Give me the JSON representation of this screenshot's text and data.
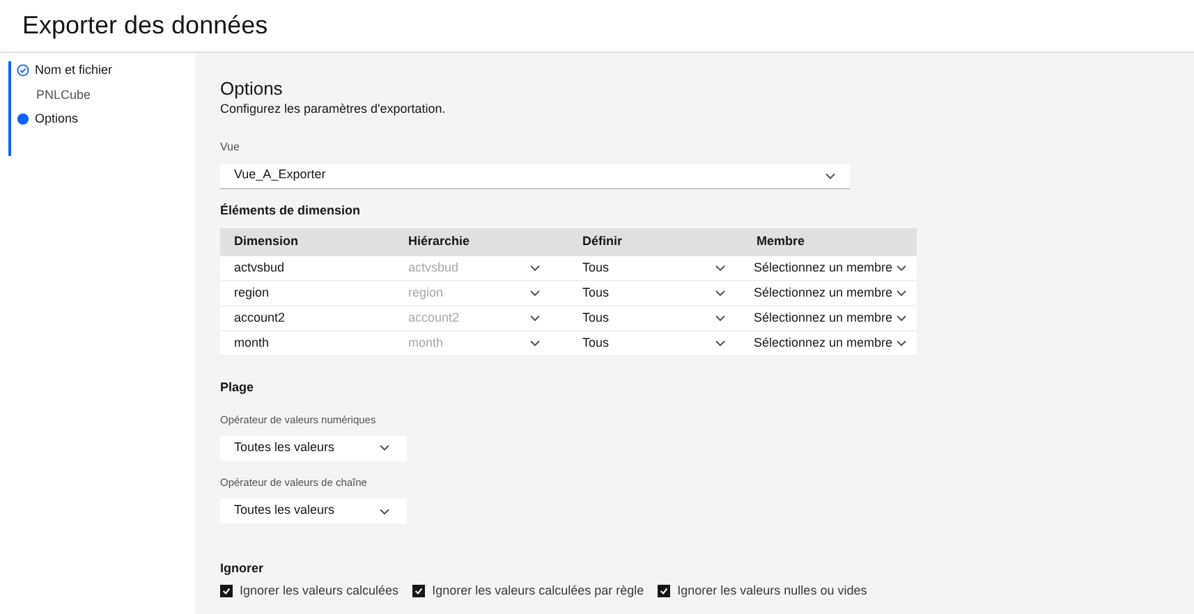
{
  "header": {
    "title": "Exporter des données"
  },
  "steps": [
    {
      "label": "Nom et fichier",
      "kind": "complete",
      "detail": "PNLCube"
    },
    {
      "label": "Options",
      "kind": "current"
    }
  ],
  "options": {
    "title": "Options",
    "subtitle": "Configurez les paramètres d'exportation.",
    "view": {
      "label": "Vue",
      "value": "Vue_A_Exporter"
    },
    "dimensions": {
      "title": "Éléments de dimension",
      "columns": [
        "Dimension",
        "Hiérarchie",
        "Définir",
        "Membre"
      ],
      "rows": [
        {
          "dimension": "actvsbud",
          "hierarchy": "actvsbud",
          "hierarchy_disabled": true,
          "define": "Tous",
          "member": "Sélectionnez un membre"
        },
        {
          "dimension": "region",
          "hierarchy": "region",
          "hierarchy_disabled": true,
          "define": "Tous",
          "member": "Sélectionnez un membre"
        },
        {
          "dimension": "account2",
          "hierarchy": "account2",
          "hierarchy_disabled": true,
          "define": "Tous",
          "member": "Sélectionnez un membre"
        },
        {
          "dimension": "month",
          "hierarchy": "month",
          "hierarchy_disabled": true,
          "define": "Tous",
          "member": "Sélectionnez un membre"
        }
      ]
    },
    "range": {
      "title": "Plage",
      "fields": [
        {
          "label": "Opérateur de valeurs numériques",
          "value": "Toutes les valeurs"
        },
        {
          "label": "Opérateur de valeurs de chaîne",
          "value": "Toutes les valeurs"
        }
      ]
    },
    "ignore": {
      "title": "Ignorer",
      "checkboxes": [
        {
          "label": "Ignorer les valeurs calculées",
          "checked": true
        },
        {
          "label": "Ignorer les valeurs calculées par règle",
          "checked": true
        },
        {
          "label": "Ignorer les valeurs nulles ou vides",
          "checked": true
        }
      ]
    }
  }
}
